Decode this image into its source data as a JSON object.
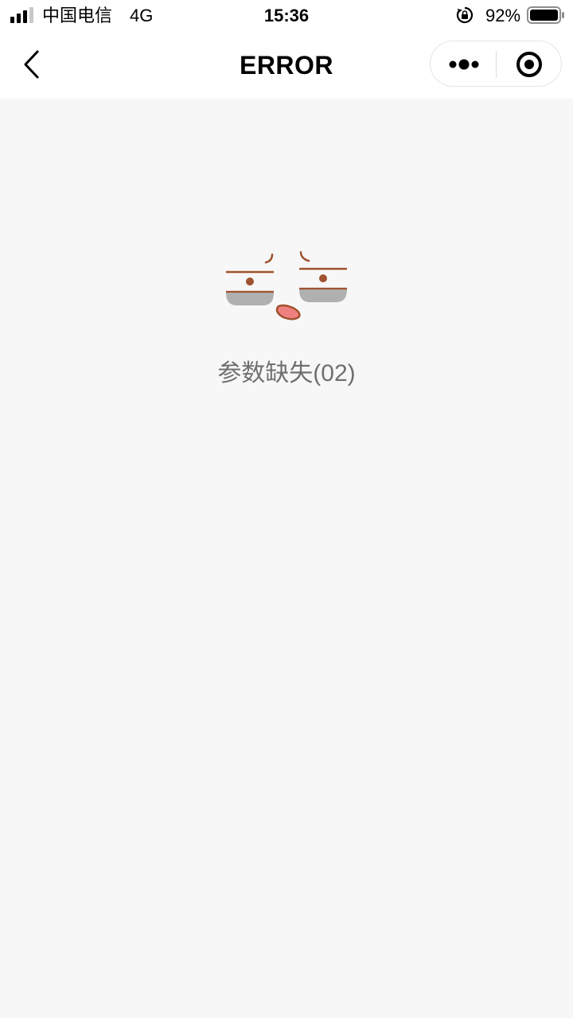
{
  "status_bar": {
    "carrier": "中国电信",
    "network": "4G",
    "time": "15:36",
    "battery_percent": "92%",
    "battery_level": 0.92
  },
  "nav": {
    "title": "ERROR"
  },
  "content": {
    "error_message": "参数缺失(02)"
  },
  "colors": {
    "background": "#f7f7f7",
    "face_line": "#a0522d",
    "tongue": "#f08080",
    "eye_shade": "#b0b0b0",
    "message_text": "#707070"
  }
}
